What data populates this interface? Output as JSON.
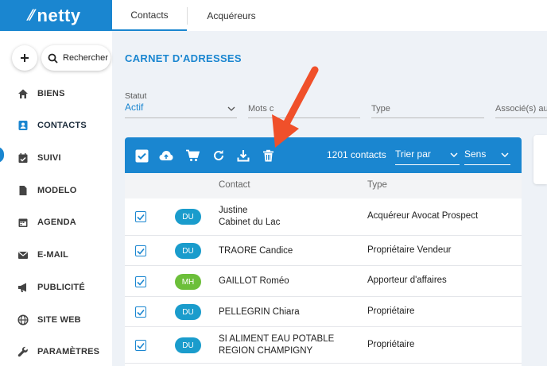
{
  "app": {
    "logo_text": "netty",
    "accent": "#1a86d0",
    "arrow_color": "#f0502a"
  },
  "top_tabs": [
    {
      "label": "Contacts",
      "active": true
    },
    {
      "label": "Acquéreurs",
      "active": false
    }
  ],
  "sidebar": {
    "plus_icon": "plus-icon",
    "search_label": "Rechercher",
    "items": [
      {
        "label": "BIENS",
        "icon": "home-icon"
      },
      {
        "label": "CONTACTS",
        "icon": "contact-card-icon",
        "active": true
      },
      {
        "label": "SUIVI",
        "icon": "calendar-check-icon"
      },
      {
        "label": "MODELO",
        "icon": "document-icon"
      },
      {
        "label": "AGENDA",
        "icon": "calendar-icon"
      },
      {
        "label": "E-MAIL",
        "icon": "envelope-icon"
      },
      {
        "label": "PUBLICITÉ",
        "icon": "megaphone-icon"
      },
      {
        "label": "SITE WEB",
        "icon": "globe-icon"
      },
      {
        "label": "PARAMÈTRES",
        "icon": "wrench-icon"
      }
    ]
  },
  "page": {
    "title": "CARNET D'ADRESSES",
    "filters": {
      "statut_label": "Statut",
      "statut_value": "Actif",
      "mots_placeholder": "Mots c",
      "type_placeholder": "Type",
      "associes_placeholder": "Associé(s) au"
    }
  },
  "toolbar": {
    "icons": [
      "select-all-checkbox-icon",
      "cloud-upload-icon",
      "cart-icon",
      "refresh-icon",
      "download-icon",
      "trash-icon"
    ],
    "count": "1201 contacts",
    "sort_label": "Trier par",
    "order_label": "Sens"
  },
  "table": {
    "headers": {
      "contact": "Contact",
      "type": "Type"
    },
    "rows": [
      {
        "badge": "DU",
        "badge_color": "#1a9ccc",
        "name_line1": "Justine",
        "name_line2": "Cabinet du Lac",
        "type": "Acquéreur Avocat Prospect",
        "checked": true
      },
      {
        "badge": "DU",
        "badge_color": "#1a9ccc",
        "name_line1": "TRAORE Candice",
        "name_line2": "",
        "type": "Propriétaire Vendeur",
        "checked": true
      },
      {
        "badge": "MH",
        "badge_color": "#6cbf3a",
        "name_line1": "GAILLOT Roméo",
        "name_line2": "",
        "type": "Apporteur d'affaires",
        "checked": true
      },
      {
        "badge": "DU",
        "badge_color": "#1a9ccc",
        "name_line1": "PELLEGRIN Chiara",
        "name_line2": "",
        "type": "Propriétaire",
        "checked": true
      },
      {
        "badge": "DU",
        "badge_color": "#1a9ccc",
        "name_line1": "SI ALIMENT EAU POTABLE",
        "name_line2": "REGION CHAMPIGNY",
        "type": "Propriétaire",
        "checked": true
      }
    ]
  }
}
